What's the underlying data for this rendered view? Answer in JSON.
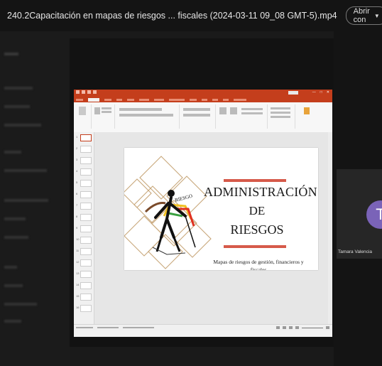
{
  "player": {
    "file_title": "240.2Capacitación en mapas de riesgos ... fiscales (2024-03-11 09_08 GMT-5).mp4",
    "open_with_label": "Abrir con"
  },
  "participant": {
    "initial": "T",
    "name": "Tamara Valencia"
  },
  "slide": {
    "title_line1": "ADMINISTRACIÓN",
    "title_line2": "DE",
    "title_line3": "RIESGOS",
    "logo_text": "RIESGO",
    "subtitle": "Mapas de riesgos de gestión, financieros y fiscales"
  },
  "colors": {
    "accent_orange": "#c43e1c",
    "stripe_red": "#d65a4a",
    "avatar_purple": "#7a63b8"
  }
}
